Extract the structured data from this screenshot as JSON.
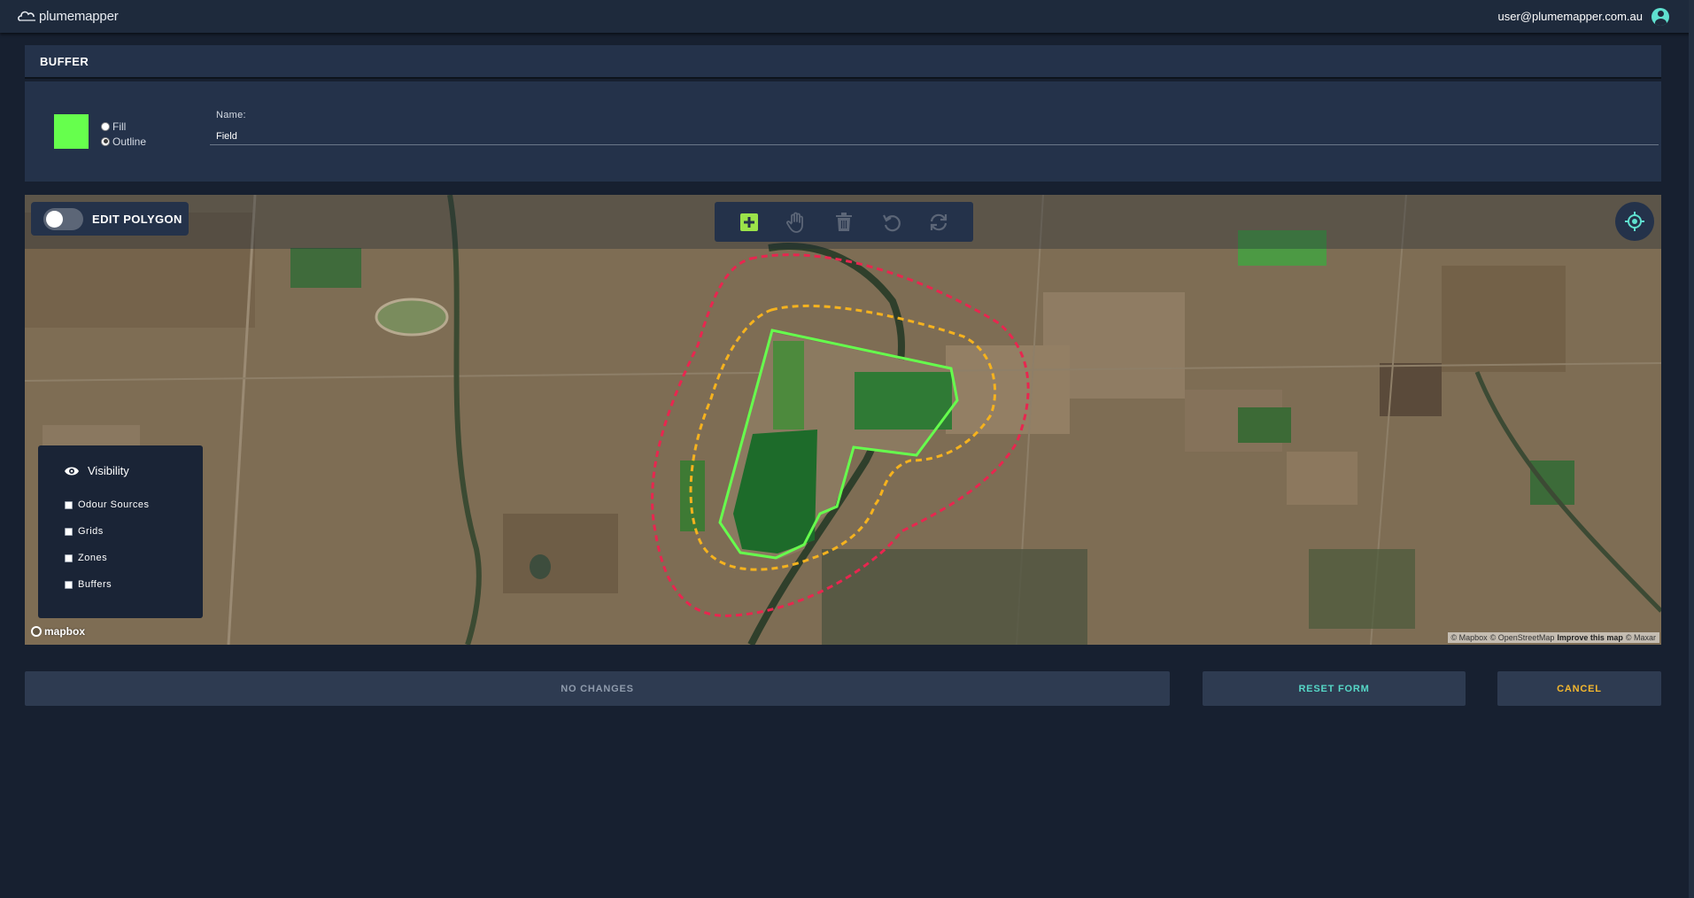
{
  "app": {
    "logo_text": "plumemapper",
    "user_email": "user@plumemapper.com.au"
  },
  "section": {
    "title": "BUFFER"
  },
  "form": {
    "swatch_color": "#66ff4d",
    "fill_label": "Fill",
    "outline_label": "Outline",
    "selected_style": "outline",
    "name_label": "Name:",
    "name_value": "Field"
  },
  "map": {
    "edit_polygon_label": "EDIT POLYGON",
    "edit_polygon_enabled": false,
    "tools": [
      {
        "icon": "add-polygon-icon",
        "active": true
      },
      {
        "icon": "hand-pan-icon",
        "active": false
      },
      {
        "icon": "trash-icon",
        "active": false
      },
      {
        "icon": "undo-icon",
        "active": false
      },
      {
        "icon": "redo-icon",
        "active": false
      }
    ],
    "visibility": {
      "title": "Visibility",
      "items": [
        "Odour Sources",
        "Grids",
        "Zones",
        "Buffers"
      ]
    },
    "mapbox_label": "mapbox",
    "attribution": {
      "mapbox": "© Mapbox",
      "osm": "© OpenStreetMap",
      "improve": "Improve this map",
      "maxar": "© Maxar"
    },
    "colors": {
      "field_outline": "#66ff4d",
      "inner_buffer": "#f5b21e",
      "outer_buffer": "#e8264f"
    }
  },
  "actions": {
    "save_label": "NO CHANGES",
    "reset_label": "RESET FORM",
    "cancel_label": "CANCEL"
  }
}
